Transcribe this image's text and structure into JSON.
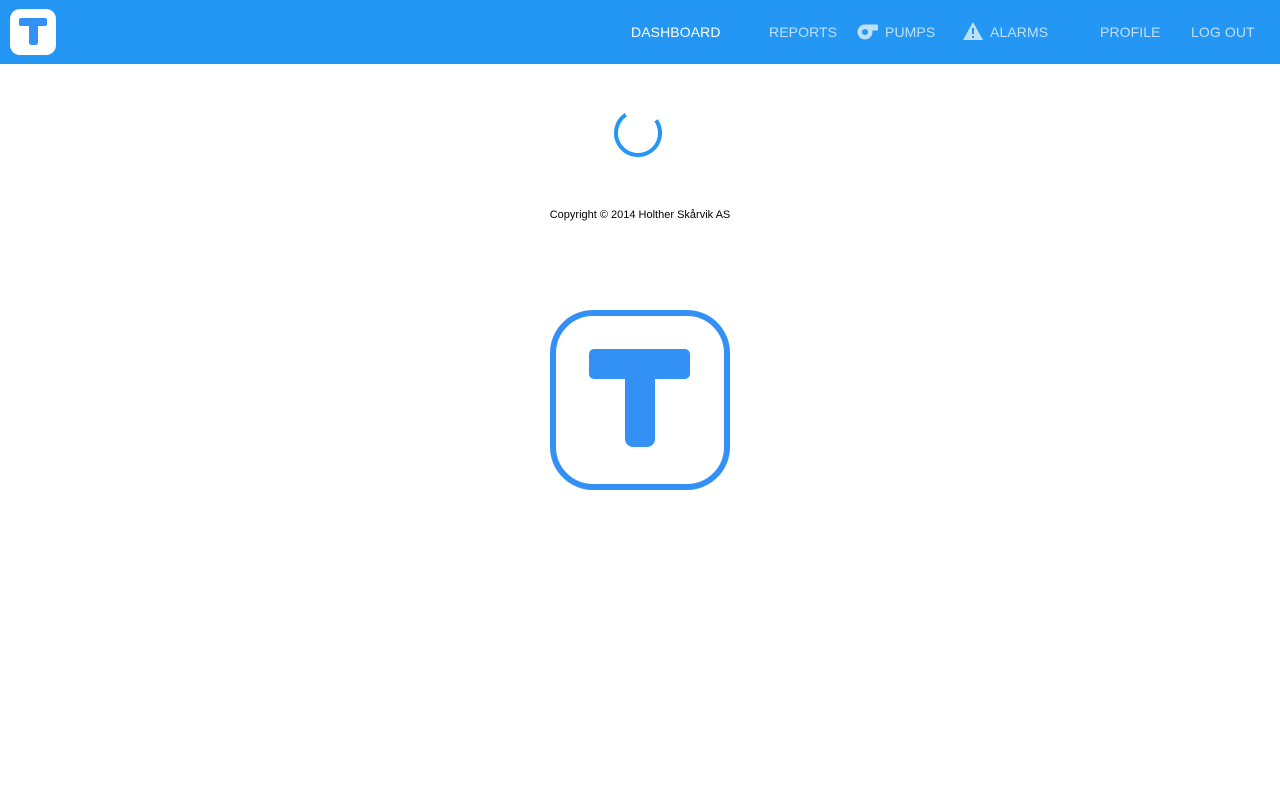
{
  "header": {
    "brand_color": "#2496f3",
    "logo_icon": "t-logo-icon",
    "nav": {
      "dashboard": "DASHBOARD",
      "reports": "REPORTS",
      "pumps": "PUMPS",
      "alarms": "ALARMS",
      "profile": "PROFILE",
      "logout": "LOG OUT"
    },
    "nav_icons": {
      "pumps": "pump-icon",
      "alarms": "warning-icon"
    },
    "active_item": "dashboard"
  },
  "main": {
    "loading_indicator": "loading-spinner-icon",
    "copyright": "Copyright © 2014 Holther Skårvik AS",
    "logo_icon": "t-logo-icon",
    "accent_color": "#3391f5"
  }
}
